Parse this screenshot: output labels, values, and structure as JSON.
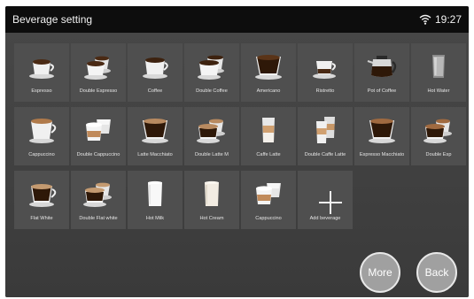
{
  "header": {
    "title": "Beverage setting",
    "time": "19:27"
  },
  "icons": {
    "wifi": "wifi-icon",
    "add": "plus-icon"
  },
  "beverages": [
    {
      "label": "Espresso",
      "icon": "espresso-cup-icon"
    },
    {
      "label": "Double Espresso",
      "icon": "double-espresso-cups-icon"
    },
    {
      "label": "Coffee",
      "icon": "coffee-cup-icon"
    },
    {
      "label": "Double Coffee",
      "icon": "double-coffee-cups-icon"
    },
    {
      "label": "Americano",
      "icon": "americano-cup-icon"
    },
    {
      "label": "Ristretto",
      "icon": "ristretto-cup-icon"
    },
    {
      "label": "Pot of Coffee",
      "icon": "coffee-pot-icon"
    },
    {
      "label": "Hot Water",
      "icon": "water-glass-icon"
    },
    {
      "label": "Cappuccino",
      "icon": "cappuccino-cup-icon"
    },
    {
      "label": "Double Cappuccino",
      "icon": "double-cappuccino-cups-icon"
    },
    {
      "label": "Latte Macchiato",
      "icon": "latte-macchiato-cup-icon"
    },
    {
      "label": "Double Latte M",
      "icon": "double-latte-macchiato-cups-icon"
    },
    {
      "label": "Caffe Latte",
      "icon": "caffe-latte-glass-icon"
    },
    {
      "label": "Double Caffe Latte",
      "icon": "double-caffe-latte-glasses-icon"
    },
    {
      "label": "Espresso Macchiato",
      "icon": "espresso-macchiato-cup-icon"
    },
    {
      "label": "Double Esp",
      "icon": "double-espresso-macchiato-cups-icon"
    },
    {
      "label": "Flat White",
      "icon": "flat-white-cup-icon"
    },
    {
      "label": "Double Flat white",
      "icon": "double-flat-white-cups-icon"
    },
    {
      "label": "Hot Milk",
      "icon": "hot-milk-glass-icon"
    },
    {
      "label": "Hot Cream",
      "icon": "hot-cream-glass-icon"
    },
    {
      "label": "Cappuccino",
      "icon": "cappuccino-cups-icon"
    }
  ],
  "add_tile": {
    "label": "Add beverage",
    "icon": "plus-icon"
  },
  "buttons": {
    "more": "More",
    "back": "Back"
  },
  "colors": {
    "status_bar": "#0d0d0d",
    "background": "#3e3e3e",
    "tile": "#4f4f4f",
    "button": "#a0a0a0"
  }
}
